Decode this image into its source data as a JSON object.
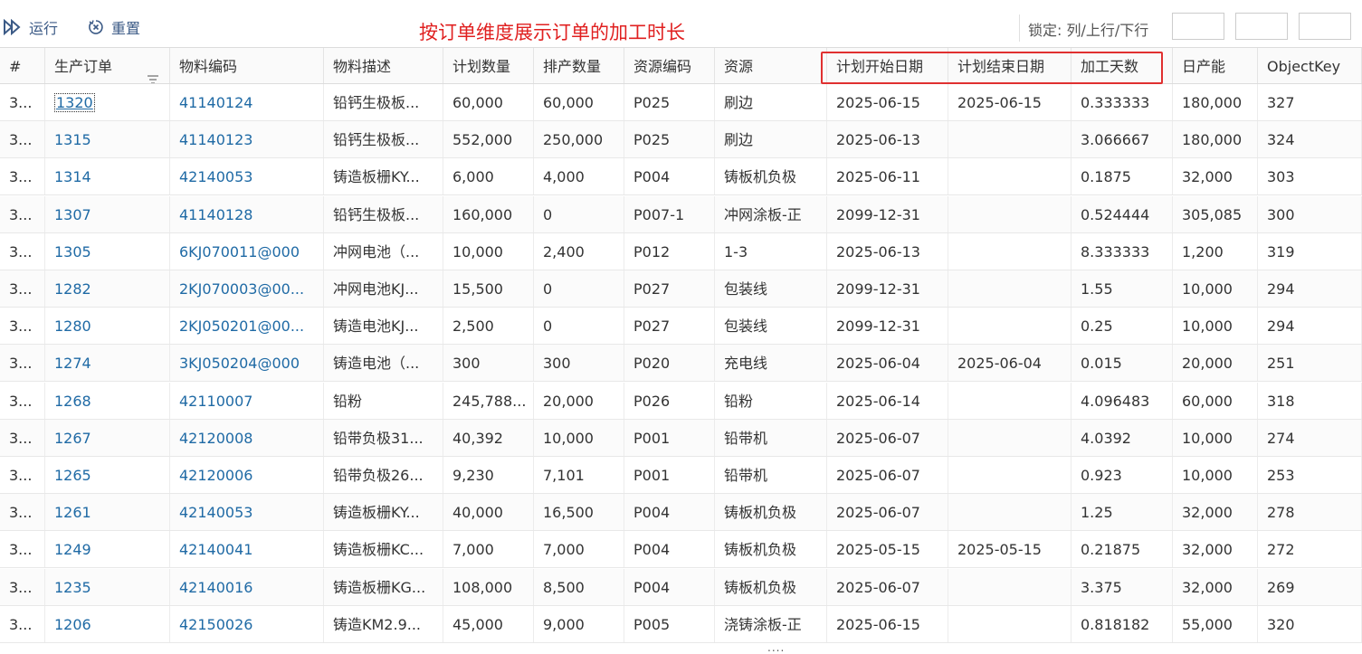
{
  "toolbar": {
    "run_label": "运行",
    "reset_label": "重置",
    "annotation": "按订单维度展示订单的加工时长",
    "lock_label": "锁定: 列/上行/下行"
  },
  "columns": [
    "#",
    "生产订单",
    "物料编码",
    "物料描述",
    "计划数量",
    "排产数量",
    "资源编码",
    "资源",
    "计划开始日期",
    "计划结束日期",
    "加工天数",
    "日产能",
    "ObjectKey"
  ],
  "rows": [
    [
      "3...",
      "1320",
      "41140124",
      "铅钙生极板...",
      "60,000",
      "60,000",
      "P025",
      "刷边",
      "2025-06-15",
      "2025-06-15",
      "0.333333",
      "180,000",
      "327"
    ],
    [
      "3...",
      "1315",
      "41140123",
      "铅钙生极板...",
      "552,000",
      "250,000",
      "P025",
      "刷边",
      "2025-06-13",
      "",
      "3.066667",
      "180,000",
      "324"
    ],
    [
      "3...",
      "1314",
      "42140053",
      "铸造板栅KY...",
      "6,000",
      "4,000",
      "P004",
      "铸板机负极",
      "2025-06-11",
      "",
      "0.1875",
      "32,000",
      "303"
    ],
    [
      "3...",
      "1307",
      "41140128",
      "铅钙生极板...",
      "160,000",
      "0",
      "P007-1",
      "冲网涂板-正",
      "2099-12-31",
      "",
      "0.524444",
      "305,085",
      "300"
    ],
    [
      "3...",
      "1305",
      "6KJ070011@000",
      "冲网电池（...",
      "10,000",
      "2,400",
      "P012",
      "1-3",
      "2025-06-13",
      "",
      "8.333333",
      "1,200",
      "319"
    ],
    [
      "3...",
      "1282",
      "2KJ070003@00...",
      "冲网电池KJ...",
      "15,500",
      "0",
      "P027",
      "包装线",
      "2099-12-31",
      "",
      "1.55",
      "10,000",
      "294"
    ],
    [
      "3...",
      "1280",
      "2KJ050201@00...",
      "铸造电池KJ...",
      "2,500",
      "0",
      "P027",
      "包装线",
      "2099-12-31",
      "",
      "0.25",
      "10,000",
      "294"
    ],
    [
      "3...",
      "1274",
      "3KJ050204@000",
      "铸造电池（...",
      "300",
      "300",
      "P020",
      "充电线",
      "2025-06-04",
      "2025-06-04",
      "0.015",
      "20,000",
      "251"
    ],
    [
      "3...",
      "1268",
      "42110007",
      "铅粉",
      "245,788...",
      "20,000",
      "P026",
      "铅粉",
      "2025-06-14",
      "",
      "4.096483",
      "60,000",
      "318"
    ],
    [
      "3...",
      "1267",
      "42120008",
      "铅带负极31...",
      "40,392",
      "10,000",
      "P001",
      "铅带机",
      "2025-06-07",
      "",
      "4.0392",
      "10,000",
      "274"
    ],
    [
      "3...",
      "1265",
      "42120006",
      "铅带负极26...",
      "9,230",
      "7,101",
      "P001",
      "铅带机",
      "2025-06-07",
      "",
      "0.923",
      "10,000",
      "253"
    ],
    [
      "3...",
      "1261",
      "42140053",
      "铸造板栅KY...",
      "40,000",
      "16,500",
      "P004",
      "铸板机负极",
      "2025-06-07",
      "",
      "1.25",
      "32,000",
      "278"
    ],
    [
      "3...",
      "1249",
      "42140041",
      "铸造板栅KC...",
      "7,000",
      "7,000",
      "P004",
      "铸板机负极",
      "2025-05-15",
      "2025-05-15",
      "0.21875",
      "32,000",
      "272"
    ],
    [
      "3...",
      "1235",
      "42140016",
      "铸造板栅KG...",
      "108,000",
      "8,500",
      "P004",
      "铸板机负极",
      "2025-06-07",
      "",
      "3.375",
      "32,000",
      "269"
    ],
    [
      "3...",
      "1206",
      "42150026",
      "铸造KM2.9...",
      "45,000",
      "9,000",
      "P005",
      "浇铸涂板-正",
      "2025-06-15",
      "",
      "0.818182",
      "55,000",
      "320"
    ]
  ],
  "footer_indicator": "....",
  "colors": {
    "link": "#1f6aa5",
    "accent": "#3b5a86",
    "annotation": "#e02020",
    "highlight_border": "#e03030"
  }
}
